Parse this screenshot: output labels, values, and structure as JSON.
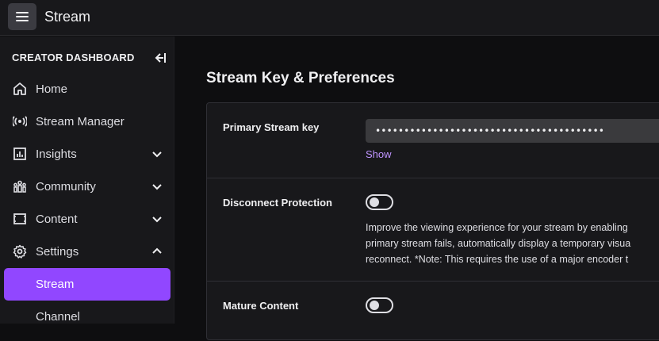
{
  "app": {
    "title": "Stream",
    "menu_icon": "hamburger-menu-icon"
  },
  "sidebar": {
    "header": "CREATOR DASHBOARD",
    "items": [
      {
        "label": "Home",
        "icon": "home-icon"
      },
      {
        "label": "Stream Manager",
        "icon": "broadcast-icon"
      },
      {
        "label": "Insights",
        "icon": "chart-icon",
        "expandable": true
      },
      {
        "label": "Community",
        "icon": "community-icon",
        "expandable": true
      },
      {
        "label": "Content",
        "icon": "content-icon",
        "expandable": true
      },
      {
        "label": "Settings",
        "icon": "gear-icon",
        "expanded": true
      },
      {
        "label": "Stream",
        "active": true
      },
      {
        "label": "Channel"
      }
    ]
  },
  "main": {
    "section_title": "Stream Key & Preferences",
    "primary_key": {
      "label": "Primary Stream key",
      "value": "••••••••••••••••••••••••••••••••••••••••",
      "show_label": "Show"
    },
    "disconnect": {
      "label": "Disconnect Protection",
      "enabled": false,
      "description_lines": [
        "Improve the viewing experience for your stream by enabling",
        "primary stream fails, automatically display a temporary visua",
        "reconnect. *Note: This requires the use of a major encoder t"
      ]
    },
    "mature": {
      "label": "Mature Content",
      "enabled": false
    }
  },
  "colors": {
    "accent": "#9147ff",
    "link": "#bf94ff",
    "background": "#0e0e10",
    "panel": "#18181b"
  }
}
